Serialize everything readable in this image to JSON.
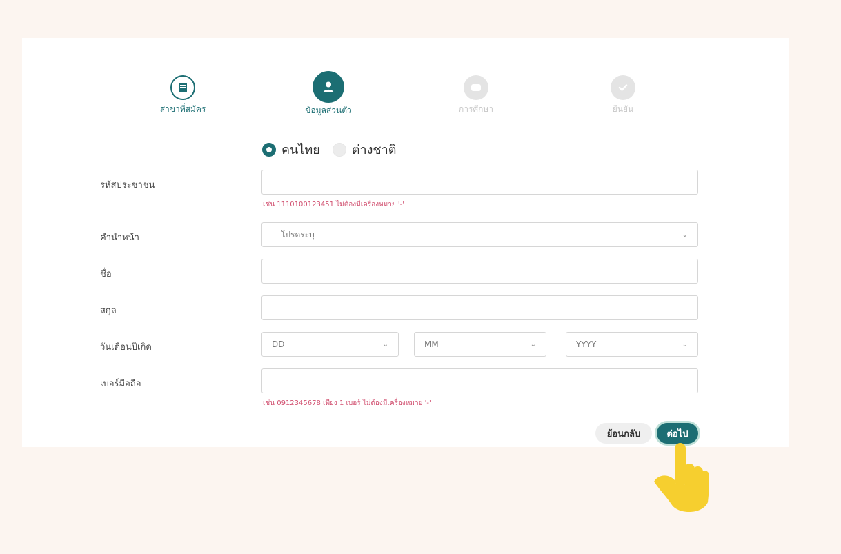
{
  "steps": [
    {
      "label": "สาขาที่สมัคร",
      "icon": "book-icon",
      "state": "done"
    },
    {
      "label": "ข้อมูลส่วนตัว",
      "icon": "person-icon",
      "state": "active"
    },
    {
      "label": "การศึกษา",
      "icon": "graduation-cap-icon",
      "state": "pending"
    },
    {
      "label": "ยืนยัน",
      "icon": "check-icon",
      "state": "pending"
    }
  ],
  "nationality": {
    "thai_label": "คนไทย",
    "foreign_label": "ต่างชาติ",
    "selected": "thai"
  },
  "form": {
    "citizen_id": {
      "label": "รหัสประชาชน",
      "value": "",
      "hint": "เช่น 1110100123451 ไม่ต้องมีเครื่องหมาย '-'"
    },
    "prefix": {
      "label": "คำนำหน้า",
      "selected": "---โปรดระบุ----"
    },
    "first_name": {
      "label": "ชื่อ",
      "value": ""
    },
    "last_name": {
      "label": "สกุล",
      "value": ""
    },
    "birthdate": {
      "label": "วันเดือนปีเกิด",
      "day": "DD",
      "month": "MM",
      "year": "YYYY"
    },
    "phone": {
      "label": "เบอร์มือถือ",
      "value": "",
      "hint": "เช่น 0912345678 เพียง 1 เบอร์ ไม่ต้องมีเครื่องหมาย '-'"
    }
  },
  "buttons": {
    "back": "ย้อนกลับ",
    "next": "ต่อไป"
  },
  "colors": {
    "primary": "#1c6e73",
    "hint": "#d14f6f",
    "background": "#fcf5f0",
    "pointer": "#f6cf2f"
  }
}
